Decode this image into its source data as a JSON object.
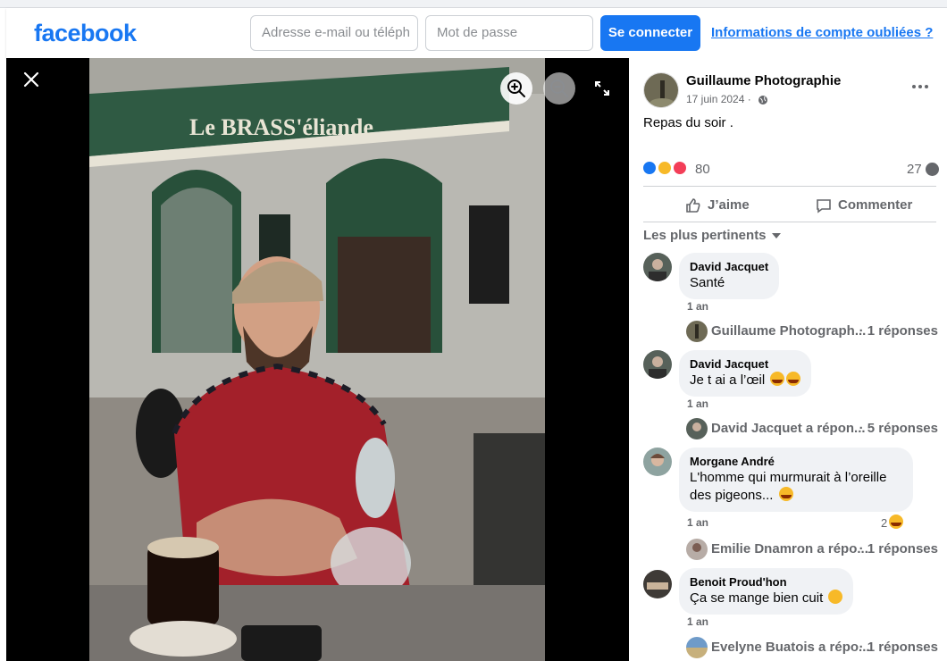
{
  "header": {
    "logo": "facebook",
    "email_placeholder": "Adresse e-mail ou téléph",
    "password_placeholder": "Mot de passe",
    "login_label": "Se connecter",
    "forgot_label": "Informations de compte oubliées ?"
  },
  "post": {
    "author": "Guillaume Photographie",
    "date": "17 juin 2024 ·",
    "text": "Repas du soir .",
    "reaction_count": "80",
    "comment_count": "27",
    "like_label": "J’aime",
    "comment_label": "Commenter",
    "sort_label": "Les plus pertinents"
  },
  "photo": {
    "sign_text": "Le BRASS'éliande"
  },
  "comments": [
    {
      "name": "David Jacquet",
      "text": "Santé",
      "time": "1 an",
      "replies_preview": "Guillaume Photograph...",
      "replies_count": "· 1 réponses"
    },
    {
      "name": "David Jacquet",
      "text": "Je t ai a l’œil",
      "time": "1 an",
      "replies_preview": "David Jacquet a répon...",
      "replies_count": "· 5 réponses"
    },
    {
      "name": "Morgane André",
      "text": "L'homme qui murmurait à l’oreille\ndes pigeons...",
      "time": "1 an",
      "reacts": "2",
      "replies_preview": "Emilie Dnamron a répo...",
      "replies_count": "· 1 réponses"
    },
    {
      "name": "Benoit Proud'hon",
      "text": "Ça se mange bien cuit",
      "time": "1 an",
      "replies_preview": "Evelyne Buatois a répo...",
      "replies_count": "· 1 réponses"
    }
  ],
  "colors": {
    "brand": "#1877f2",
    "secondary_text": "#65676b",
    "bubble": "#f0f2f5"
  }
}
